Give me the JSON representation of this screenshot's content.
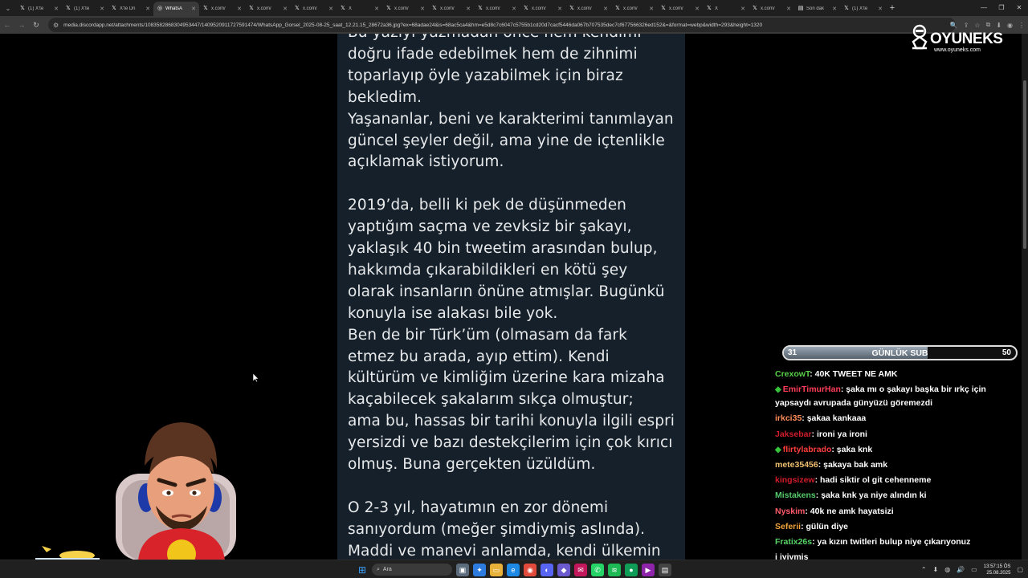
{
  "browser": {
    "tabs": [
      {
        "icon": "x-logo-icon",
        "label": "(1) X'te",
        "active": false
      },
      {
        "icon": "x-logo-icon",
        "label": "(1) X'te",
        "active": false
      },
      {
        "icon": "x-logo-icon",
        "label": "X'te Dn",
        "active": false
      },
      {
        "icon": "globe-icon",
        "label": "WhatsA",
        "active": true
      },
      {
        "icon": "x-logo-icon",
        "label": "x.com/",
        "active": false
      },
      {
        "icon": "x-logo-icon",
        "label": "x.com/",
        "active": false
      },
      {
        "icon": "x-logo-icon",
        "label": "x.com/",
        "active": false
      },
      {
        "icon": "x-logo-icon",
        "label": "X",
        "active": false
      },
      {
        "icon": "x-logo-icon",
        "label": "x.com/",
        "active": false
      },
      {
        "icon": "x-logo-icon",
        "label": "x.com/",
        "active": false
      },
      {
        "icon": "x-logo-icon",
        "label": "x.com/",
        "active": false
      },
      {
        "icon": "x-logo-icon",
        "label": "x.com/",
        "active": false
      },
      {
        "icon": "x-logo-icon",
        "label": "x.com/",
        "active": false
      },
      {
        "icon": "x-logo-icon",
        "label": "x.com/",
        "active": false
      },
      {
        "icon": "x-logo-icon",
        "label": "x.com/",
        "active": false
      },
      {
        "icon": "x-logo-icon",
        "label": "X",
        "active": false
      },
      {
        "icon": "x-logo-icon",
        "label": "x.com/",
        "active": false
      },
      {
        "icon": "page-icon",
        "label": "Son dak",
        "active": false
      },
      {
        "icon": "x-logo-icon",
        "label": "(1) X'te",
        "active": false
      }
    ],
    "url": "media.discordapp.net/attachments/1083582868304953447/1409520911727591474/WhatsApp_Gorsel_2025-08-25_saat_12.21.15_28672a36.jpg?ex=68adae24&is=68ac5ca4&hm=e5d8c7c6047c5755b1cd20d7cacf5446da067b707535dec7cf677566326ed152&=&format=webp&width=293&height=1320"
  },
  "article": {
    "block1": [
      "Bu yazıyı yazmadan önce hem kendimi",
      "doğru ifade edebilmek hem de zihnimi",
      "toparlayıp öyle yazabilmek için biraz",
      "bekledim.",
      "Yaşananlar, beni ve karakterimi tanımlayan",
      "güncel şeyler değil, ama yine de içtenlikle",
      "açıklamak istiyorum."
    ],
    "block2": [
      "2019’da, belli ki pek de düşünmeden",
      "yaptığım saçma ve zevksiz bir şakayı,",
      "yaklaşık 40 bin tweetim arasından bulup,",
      "hakkımda çıkarabildikleri en kötü şey",
      "olarak insanların önüne atmışlar. Bugünkü",
      "konuyla ise alakası bile yok.",
      "Ben de bir Türk’üm (olmasam da fark",
      "etmez bu arada, ayıp ettim). Kendi",
      "kültürüm ve kimliğim üzerine kara mizaha",
      "kaçabilecek şakalarım sıkça olmuştur;",
      "ama bu, hassas bir tarihi konuyla ilgili espri",
      "yersizdi ve bazı destekçilerim için çok kırıcı",
      "olmuş. Buna gerçekten üzüldüm."
    ],
    "block3": [
      "O 2-3 yıl, hayatımın en zor dönemi",
      "sanıyordum (meğer şimdiymiş aslında).",
      "Maddi ve manevi anlamda, kendi ülkemin"
    ]
  },
  "overlay": {
    "brand": "OYUNEKS",
    "site": "www.oyuneks.com",
    "sub_goal": {
      "current": "31",
      "label": "GÜNLÜK SUB",
      "target": "50",
      "progress": 0.62
    }
  },
  "chat": [
    {
      "user": "CrexowT",
      "text": ": 40K TWEET NE AMK",
      "color": "#57d148",
      "badge": false
    },
    {
      "user": "EmirTimurHan",
      "text": ": şaka mı o şakayı başka bir ırkç için yapsaydı avrupada günyüzü göremezdi",
      "color": "#ff3d5a",
      "badge": true
    },
    {
      "user": "irkci35",
      "text": ": şakaa kankaaa",
      "color": "#ff8c5a",
      "badge": false
    },
    {
      "user": "Jaksebar",
      "text": ": ironi ya ironi",
      "color": "#d01c2a",
      "badge": false
    },
    {
      "user": "flirtylabrado",
      "text": ": şaka knk",
      "color": "#ff3d3d",
      "badge": true
    },
    {
      "user": "mete35456",
      "text": ": şakaya bak amk",
      "color": "#f0c070",
      "badge": false
    },
    {
      "user": "kingsizew",
      "text": ": hadi siktir ol git cehenneme",
      "color": "#d01c2a",
      "badge": false
    },
    {
      "user": "Mistakens",
      "text": ": şaka knk ya niye alındın ki",
      "color": "#54c96a",
      "badge": false
    },
    {
      "user": "Nyskim",
      "text": ": 40k ne amk hayatsizi",
      "color": "#ff5a6a",
      "badge": false
    },
    {
      "user": "Seferii",
      "text": ": gülün diye",
      "color": "#f2a33a",
      "badge": false
    },
    {
      "user": "Fratix26s",
      "text": ": ya kızın twitleri bulup niye çıkarıyonuz",
      "color": "#56d466",
      "badge": false
    },
    {
      "user": "",
      "text": "i iyiymiş",
      "color": "#ffffff",
      "badge": false
    }
  ],
  "taskbar": {
    "search_label": "Ara",
    "time": "13:57:15 ÖS",
    "date": "25.08.2025"
  }
}
